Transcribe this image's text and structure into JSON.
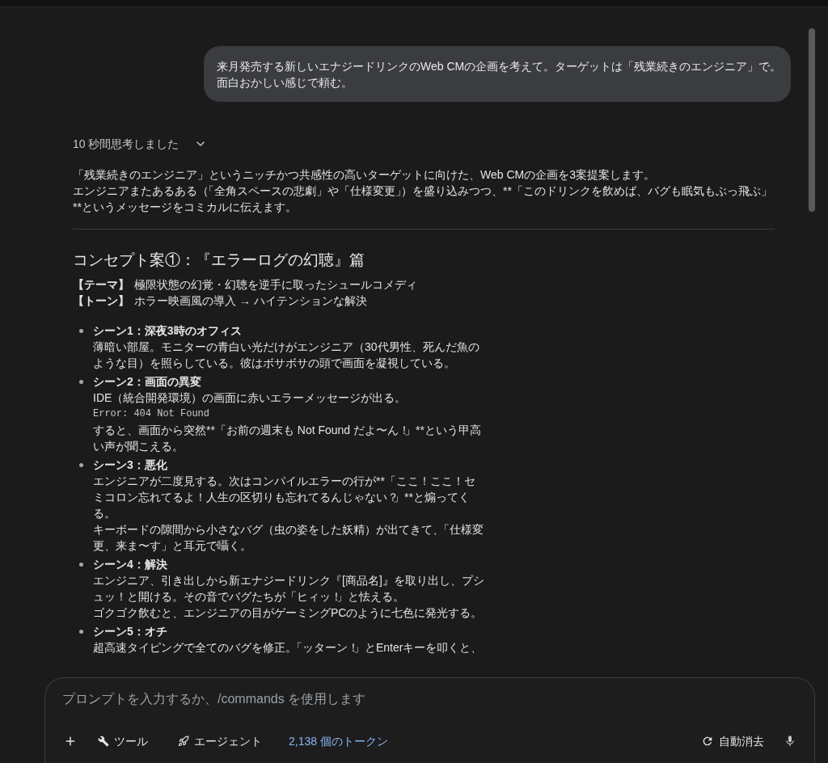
{
  "user_message": {
    "text": "来月発売する新しいエナジードリンクのWeb CMの企画を考えて。ターゲットは「残業続きのエンジニア」で。面白おかしい感じで頼む。"
  },
  "response": {
    "thinking": {
      "label": "10 秒間思考しました",
      "expanded": false
    },
    "intro": [
      "「残業続きのエンジニア」というニッチかつ共感性の高いターゲットに向けた、Web CMの企画を3案提案します。",
      "エンジニアまたあるある（「全角スペースの悲劇」や「仕様変更」）を盛り込みつつ、**「このドリンクを飲めば、バグも眠気もぶっ飛ぶ」**というメッセージをコミカルに伝えます。"
    ],
    "concept": {
      "heading": "コンセプト案①：『エラーログの幻聴』篇",
      "attributes": [
        {
          "label": "【テーマ】",
          "value": "極限状態の幻覚・幻聴を逆手に取ったシュールコメディ"
        },
        {
          "label": "【トーン】",
          "value": "ホラー映画風の導入 → ハイテンションな解決"
        }
      ],
      "scenes": [
        {
          "title": "シーン1：深夜3時のオフィス",
          "body": [
            {
              "kind": "text",
              "text": "薄暗い部屋。モニターの青白い光だけがエンジニア（30代男性、死んだ魚のような目）を照らしている。彼はボサボサの頭で画面を凝視している。"
            }
          ]
        },
        {
          "title": "シーン2：画面の異変",
          "body": [
            {
              "kind": "text",
              "text": "IDE（統合開発環境）の画面に赤いエラーメッセージが出る。"
            },
            {
              "kind": "code",
              "text": "Error: 404 Not Found"
            },
            {
              "kind": "text",
              "text": "すると、画面から突然**「お前の週末も Not Found だよ〜ん！」**という甲高い声が聞こえる。"
            }
          ]
        },
        {
          "title": "シーン3：悪化",
          "body": [
            {
              "kind": "text",
              "text": "エンジニアが二度見する。次はコンパイルエラーの行が**「ここ！ここ！セミコロン忘れてるよ！人生の区切りも忘れてるんじゃない？」**と煽ってくる。"
            },
            {
              "kind": "text",
              "text": "キーボードの隙間から小さなバグ（虫の姿をした妖精）が出てきて、「仕様変更、来ま〜す」と耳元で囁く。"
            }
          ]
        },
        {
          "title": "シーン4：解決",
          "body": [
            {
              "kind": "text",
              "text": "エンジニア、引き出しから新エナジードリンク『[商品名]』を取り出し、プシュッ！と開ける。その音でバグたちが「ヒィッ！」と怯える。"
            },
            {
              "kind": "text",
              "text": "ゴクゴク飲むと、エンジニアの目がゲーミングPCのように七色に発光する。"
            }
          ]
        },
        {
          "title": "シーン5：オチ",
          "body": [
            {
              "kind": "text",
              "text": "超高速タイピングで全てのバグを修正。「ッターン！」とEnterキーを叩くと、"
            }
          ]
        }
      ]
    }
  },
  "composer": {
    "placeholder": "プロンプトを入力するか、/commands を使用します",
    "tools_label": "ツール",
    "agent_label": "エージェント",
    "token_count": "2,138 個のトークン",
    "auto_delete_label": "自動消去"
  }
}
